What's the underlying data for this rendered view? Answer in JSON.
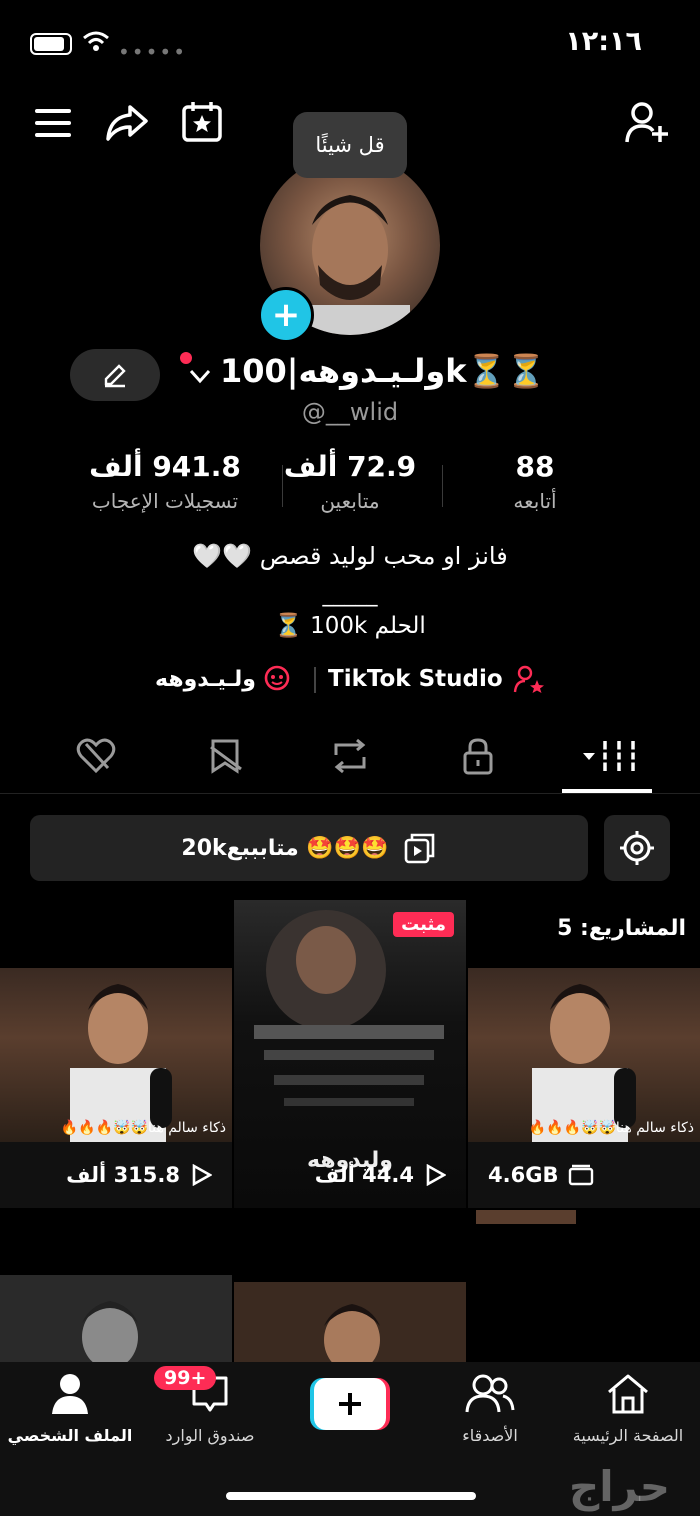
{
  "status_bar": {
    "time": "١٢:١٦"
  },
  "profile": {
    "speech_bubble": "قل شيئًا",
    "display_name": "ولـيـدوهه|100k⏳⏳",
    "username": "@__wlid",
    "stats": [
      {
        "value": "88",
        "label": "أتابعه"
      },
      {
        "value": "72.9 ألف",
        "label": "متابعين"
      },
      {
        "value": "941.8 ألف",
        "label": "تسجيلات الإعجاب"
      }
    ],
    "bio_line1": "فانز او محب لوليد قصص 🤍🤍",
    "bio_line2": "_____",
    "bio_line3": "الحلم 100k ⏳",
    "studio_link": "TikTok Studio",
    "group_link": "ولـيـدوهه"
  },
  "playlist_banner": "20kمتابببع 🤩🤩🤩",
  "grid": {
    "drafts_label": "المشاريع: 5",
    "drafts_size": "4.6GB",
    "pinned_badge": "مثبت",
    "pinned_caption": "وليدوهه",
    "video_caption": "ذكاء سالم هنا🤯🤯🔥🔥🔥",
    "video_views": "315.8 ألف",
    "pinned_views": "44.4 ألف"
  },
  "bottom_nav": {
    "home": "الصفحة الرئيسية",
    "friends": "الأصدقاء",
    "inbox": "صندوق الوارد",
    "inbox_badge": "99+",
    "profile": "الملف الشخصي"
  },
  "watermark": "حراج",
  "colors": {
    "accent_cyan": "#20c5e6",
    "accent_red": "#fe2c55"
  }
}
